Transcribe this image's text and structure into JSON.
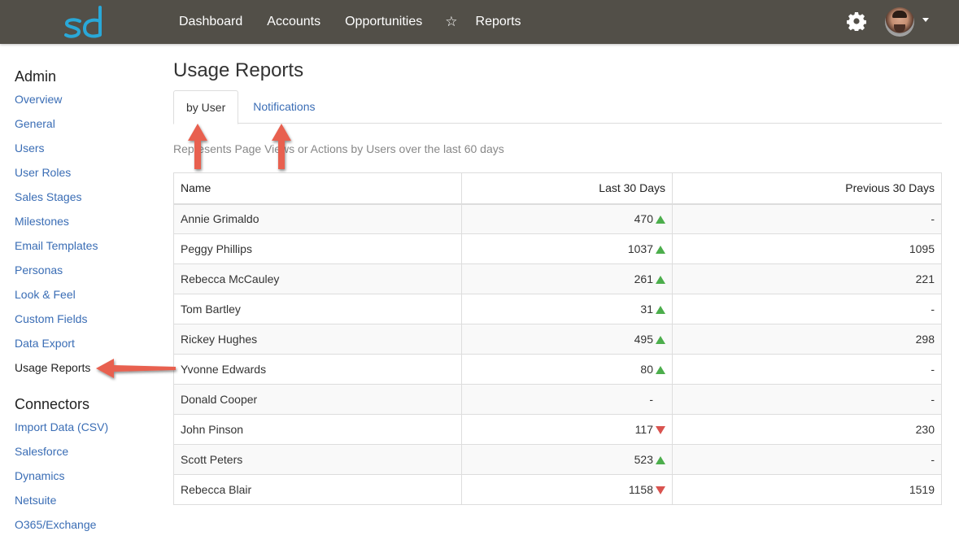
{
  "app": {
    "logo_text": "sd",
    "brand_color": "#29a8d8",
    "topbar_color": "#524f48"
  },
  "nav": {
    "items": [
      {
        "label": "Dashboard"
      },
      {
        "label": "Accounts"
      },
      {
        "label": "Opportunities"
      },
      {
        "label": "Reports"
      }
    ],
    "star_icon": "☆"
  },
  "sidebar": {
    "admin_heading": "Admin",
    "admin_items": [
      {
        "label": "Overview"
      },
      {
        "label": "General"
      },
      {
        "label": "Users"
      },
      {
        "label": "User Roles"
      },
      {
        "label": "Sales Stages"
      },
      {
        "label": "Milestones"
      },
      {
        "label": "Email Templates"
      },
      {
        "label": "Personas"
      },
      {
        "label": "Look & Feel"
      },
      {
        "label": "Custom Fields"
      },
      {
        "label": "Data Export"
      },
      {
        "label": "Usage Reports",
        "active": true
      }
    ],
    "connectors_heading": "Connectors",
    "connector_items": [
      {
        "label": "Import Data (CSV)"
      },
      {
        "label": "Salesforce"
      },
      {
        "label": "Dynamics"
      },
      {
        "label": "Netsuite"
      },
      {
        "label": "O365/Exchange"
      }
    ]
  },
  "main": {
    "title": "Usage Reports",
    "tabs": [
      {
        "label": "by User",
        "active": true
      },
      {
        "label": "Notifications",
        "active": false
      }
    ],
    "description": "Represents Page Views or Actions by Users over the last 60 days",
    "table": {
      "headers": [
        "Name",
        "Last 30 Days",
        "Previous 30 Days"
      ],
      "rows": [
        {
          "name": "Annie Grimaldo",
          "last": "470",
          "trend": "up",
          "previous": "-"
        },
        {
          "name": "Peggy Phillips",
          "last": "1037",
          "trend": "up",
          "previous": "1095"
        },
        {
          "name": "Rebecca McCauley",
          "last": "261",
          "trend": "up",
          "previous": "221"
        },
        {
          "name": "Tom Bartley",
          "last": "31",
          "trend": "up",
          "previous": "-"
        },
        {
          "name": "Rickey Hughes",
          "last": "495",
          "trend": "up",
          "previous": "298"
        },
        {
          "name": "Yvonne Edwards",
          "last": "80",
          "trend": "up",
          "previous": "-"
        },
        {
          "name": "Donald Cooper",
          "last": "-",
          "trend": "none",
          "previous": "-"
        },
        {
          "name": "John Pinson",
          "last": "117",
          "trend": "down",
          "previous": "230"
        },
        {
          "name": "Scott Peters",
          "last": "523",
          "trend": "up",
          "previous": "-"
        },
        {
          "name": "Rebecca Blair",
          "last": "1158",
          "trend": "down",
          "previous": "1519"
        }
      ]
    },
    "trend_colors": {
      "up": "#4cae4c",
      "down": "#d9534f"
    }
  },
  "annotations": {
    "arrow_color": "#e8604f"
  }
}
